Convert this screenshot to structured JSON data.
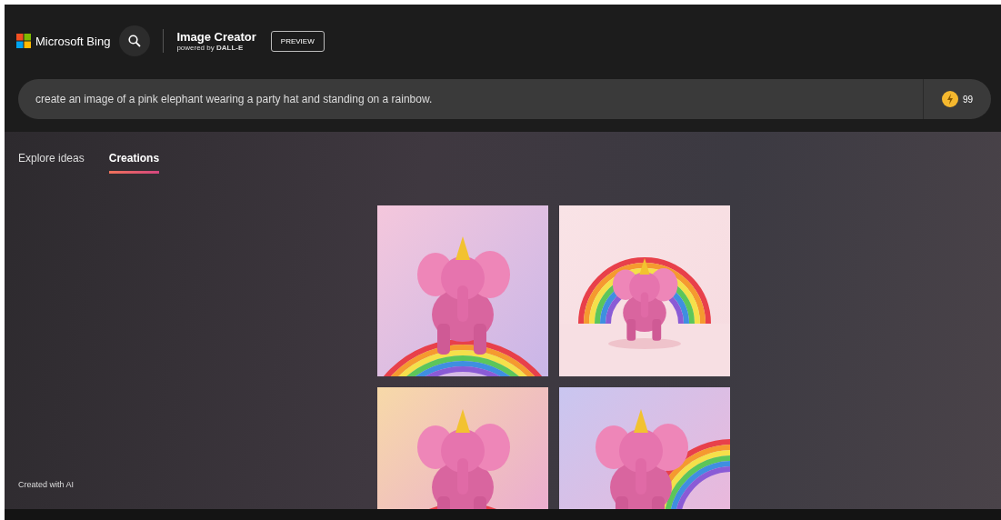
{
  "header": {
    "brand": "Microsoft Bing",
    "title": "Image Creator",
    "subtitle": "powered by **DALL-E**",
    "badge": "PREVIEW"
  },
  "prompt": {
    "value": "create an image of a pink elephant wearing a party hat and standing on a rainbow.",
    "coins": "99"
  },
  "tabs": [
    {
      "label": "Explore ideas",
      "selected": false
    },
    {
      "label": "Creations",
      "selected": true
    }
  ],
  "footer_note": "Created with AI"
}
